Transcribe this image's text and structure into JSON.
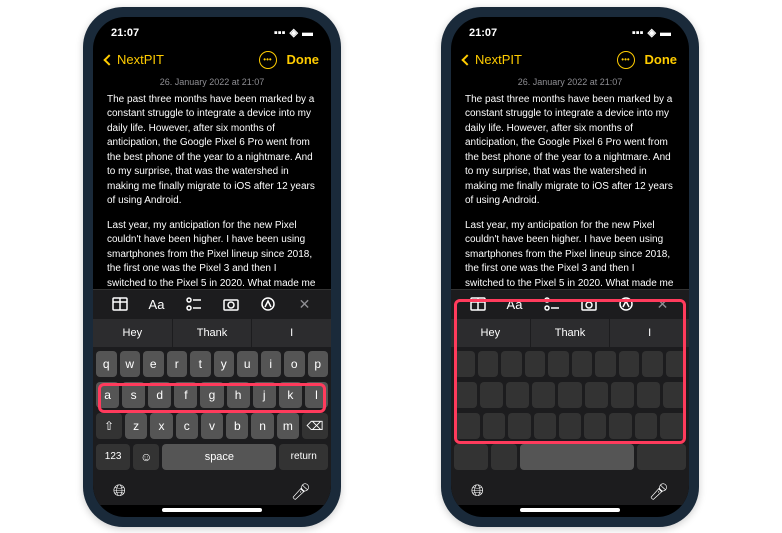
{
  "status": {
    "time": "21:07"
  },
  "nav": {
    "back": "NextPIT",
    "done": "Done"
  },
  "datetime": "26. January 2022 at 21:07",
  "note": {
    "p1": "The past three months have been marked by a constant struggle to integrate a device into my daily life. However, after six months of anticipation, the Google Pixel 6 Pro went from the best phone of the year to a nightmare. And to my surprise, that was the watershed in making me finally migrate to iOS after 12 years of using Android.",
    "p2": "Last year, my anticipation for the new Pixel couldn't have been higher. I have been using smartphones from the Pixel lineup since 2018, the first one was the Pixel 3 and then I switched to the Pixel 5 in 2020. What made me choose a Google phone back then was the experience with the camera software. In"
  },
  "suggestions": [
    "Hey",
    "Thank",
    "I"
  ],
  "keys": {
    "r1": [
      "q",
      "w",
      "e",
      "r",
      "t",
      "y",
      "u",
      "i",
      "o",
      "p"
    ],
    "r2": [
      "a",
      "s",
      "d",
      "f",
      "g",
      "h",
      "j",
      "k",
      "l"
    ],
    "r3": [
      "z",
      "x",
      "c",
      "v",
      "b",
      "n",
      "m"
    ],
    "num": "123",
    "space": "space",
    "return": "return"
  },
  "toolbar": {
    "aa": "Aa"
  }
}
